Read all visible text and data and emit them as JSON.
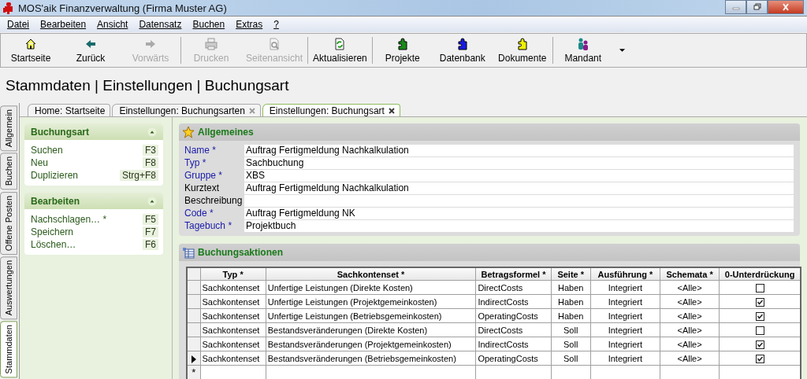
{
  "window": {
    "title": "MOS'aik Finanzverwaltung (Firma Muster AG)"
  },
  "menu": [
    "Datei",
    "Bearbeiten",
    "Ansicht",
    "Datensatz",
    "Buchen",
    "Extras",
    "?"
  ],
  "toolbar": [
    {
      "label": "Startseite",
      "disabled": false
    },
    {
      "label": "Zurück",
      "disabled": false
    },
    {
      "label": "Vorwärts",
      "disabled": true
    },
    {
      "label": "Drucken",
      "disabled": true
    },
    {
      "label": "Seitenansicht",
      "disabled": true
    },
    {
      "label": "Aktualisieren",
      "disabled": false
    },
    {
      "label": "Projekte",
      "disabled": false
    },
    {
      "label": "Datenbank",
      "disabled": false
    },
    {
      "label": "Dokumente",
      "disabled": false
    },
    {
      "label": "Mandant",
      "disabled": false
    }
  ],
  "heading": "Stammdaten | Einstellungen | Buchungsart",
  "side_tabs": [
    {
      "label": "Allgemein",
      "selected": false
    },
    {
      "label": "Buchen",
      "selected": false
    },
    {
      "label": "Offene Posten",
      "selected": false
    },
    {
      "label": "Auswertungen",
      "selected": false
    },
    {
      "label": "Stammdaten",
      "selected": true
    }
  ],
  "doc_tabs": [
    {
      "label": "Home: Startseite",
      "selected": false,
      "closable": false
    },
    {
      "label": "Einstellungen: Buchungsarten",
      "selected": false,
      "closable": true
    },
    {
      "label": "Einstellungen: Buchungsart",
      "selected": true,
      "closable": true
    }
  ],
  "task_panels": [
    {
      "title": "Buchungsart",
      "items": [
        {
          "label": "Suchen",
          "shortcut": "F3"
        },
        {
          "label": "Neu",
          "shortcut": "F8"
        },
        {
          "label": "Duplizieren",
          "shortcut": "Strg+F8"
        }
      ]
    },
    {
      "title": "Bearbeiten",
      "items": [
        {
          "label": "Nachschlagen… *",
          "shortcut": "F5"
        },
        {
          "label": "Speichern",
          "shortcut": "F7"
        },
        {
          "label": "Löschen…",
          "shortcut": "F6"
        }
      ]
    }
  ],
  "general": {
    "title": "Allgemeines",
    "fields": [
      {
        "label": "Name *",
        "required": true,
        "value": "Auftrag Fertigmeldung Nachkalkulation"
      },
      {
        "label": "Typ *",
        "required": true,
        "value": "Sachbuchung"
      },
      {
        "label": "Gruppe *",
        "required": true,
        "value": "XBS"
      },
      {
        "label": "Kurztext",
        "required": false,
        "value": "Auftrag Fertigmeldung Nachkalkulation"
      },
      {
        "label": "Beschreibung",
        "required": false
      },
      {
        "label": "Code *",
        "required": true,
        "value": "Auftrag Fertigmeldung NK"
      },
      {
        "label": "Tagebuch *",
        "required": true,
        "value": "Projektbuch"
      }
    ]
  },
  "actions": {
    "title": "Buchungsaktionen",
    "columns": [
      "Typ *",
      "Sachkontenset *",
      "Betragsformel *",
      "Seite *",
      "Ausführung *",
      "Schemata *",
      "0-Unterdrückung"
    ],
    "rows": [
      {
        "current": false,
        "typ": "Sachkontenset",
        "set": "Unfertige Leistungen (Direkte Kosten)",
        "formel": "DirectCosts",
        "seite": "Haben",
        "ausfuehrung": "Integriert",
        "schemata": "<Alle>",
        "checked": false
      },
      {
        "current": false,
        "typ": "Sachkontenset",
        "set": "Unfertige Leistungen (Projektgemeinkosten)",
        "formel": "IndirectCosts",
        "seite": "Haben",
        "ausfuehrung": "Integriert",
        "schemata": "<Alle>",
        "checked": true
      },
      {
        "current": false,
        "typ": "Sachkontenset",
        "set": "Unfertige Leistungen (Betriebsgemeinkosten)",
        "formel": "OperatingCosts",
        "seite": "Haben",
        "ausfuehrung": "Integriert",
        "schemata": "<Alle>",
        "checked": true
      },
      {
        "current": false,
        "typ": "Sachkontenset",
        "set": "Bestandsveränderungen (Direkte Kosten)",
        "formel": "DirectCosts",
        "seite": "Soll",
        "ausfuehrung": "Integriert",
        "schemata": "<Alle>",
        "checked": false
      },
      {
        "current": false,
        "typ": "Sachkontenset",
        "set": "Bestandsveränderungen (Projektgemeinkosten)",
        "formel": "IndirectCosts",
        "seite": "Soll",
        "ausfuehrung": "Integriert",
        "schemata": "<Alle>",
        "checked": true
      },
      {
        "current": true,
        "typ": "Sachkontenset",
        "set": "Bestandsveränderungen (Betriebsgemeinkosten)",
        "formel": "OperatingCosts",
        "seite": "Soll",
        "ausfuehrung": "Integriert",
        "schemata": "<Alle>",
        "checked": true
      }
    ],
    "new_row_marker": "*"
  }
}
